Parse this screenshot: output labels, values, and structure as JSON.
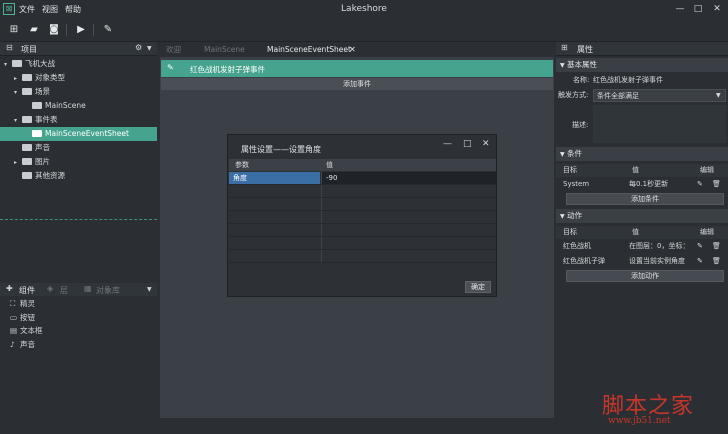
{
  "titlebar": {
    "title": "Lakeshore",
    "menu": [
      "文件",
      "视图",
      "帮助"
    ],
    "app_icon": "app-logo-icon",
    "controls": [
      "—",
      "□",
      "✕"
    ]
  },
  "toolbar": {
    "icons": [
      "new-project-icon",
      "open-folder-icon",
      "save-icon",
      "play-icon",
      "brush-icon"
    ],
    "glyphs": [
      "⊞",
      "▰",
      "◙",
      "▶",
      "✎"
    ]
  },
  "project_panel": {
    "title": "项目",
    "tree": [
      {
        "label": "飞机大战",
        "depth": 0,
        "arrow": "▾",
        "icon": "project"
      },
      {
        "label": "对象类型",
        "depth": 1,
        "arrow": "▸",
        "icon": "folder"
      },
      {
        "label": "场景",
        "depth": 1,
        "arrow": "▾",
        "icon": "folder"
      },
      {
        "label": "MainScene",
        "depth": 2,
        "arrow": "",
        "icon": "scene"
      },
      {
        "label": "事件表",
        "depth": 1,
        "arrow": "▾",
        "icon": "folder"
      },
      {
        "label": "MainSceneEventSheet",
        "depth": 2,
        "arrow": "",
        "icon": "sheet",
        "selected": true
      },
      {
        "label": "声音",
        "depth": 1,
        "arrow": "",
        "icon": "folder"
      },
      {
        "label": "图片",
        "depth": 1,
        "arrow": "▸",
        "icon": "folder"
      },
      {
        "label": "其他资源",
        "depth": 1,
        "arrow": "",
        "icon": "folder"
      }
    ]
  },
  "components_panel": {
    "tabs": [
      "组件",
      "层",
      "对象库"
    ],
    "items": [
      {
        "label": "精灵",
        "icon": "sprite-icon",
        "glyph": "⛶"
      },
      {
        "label": "按钮",
        "icon": "button-icon",
        "glyph": "▭"
      },
      {
        "label": "文本框",
        "icon": "textbox-icon",
        "glyph": "▤"
      },
      {
        "label": "声音",
        "icon": "sound-icon",
        "glyph": "♪"
      }
    ]
  },
  "editor": {
    "tabs": [
      {
        "label": "欢迎",
        "active": false
      },
      {
        "label": "MainScene",
        "active": false
      },
      {
        "label": "MainSceneEventSheet",
        "active": true
      }
    ],
    "tab_close": "✕",
    "event_title": "红色战机发射子弹事件",
    "add_event_label": "添加事件"
  },
  "dialog": {
    "title": "属性设置——设置角度",
    "controls": [
      "—",
      "□",
      "✕"
    ],
    "columns": [
      "参数",
      "值"
    ],
    "rows": [
      {
        "param": "角度",
        "value": "-90"
      },
      {
        "param": "",
        "value": ""
      },
      {
        "param": "",
        "value": ""
      },
      {
        "param": "",
        "value": ""
      },
      {
        "param": "",
        "value": ""
      },
      {
        "param": "",
        "value": ""
      },
      {
        "param": "",
        "value": ""
      }
    ],
    "ok_label": "确定"
  },
  "properties": {
    "title": "属性",
    "basic_section": "基本属性",
    "name_label": "名称:",
    "name_value": "红色战机发射子弹事件",
    "trigger_label": "触发方式:",
    "trigger_value": "条件全部满足",
    "desc_label": "描述:",
    "conditions_section": "条件",
    "conditions_columns": [
      "目标",
      "值",
      "编辑"
    ],
    "conditions_rows": [
      {
        "target": "System",
        "value": "每0.1秒更新"
      }
    ],
    "add_condition_label": "添加条件",
    "actions_section": "动作",
    "actions_columns": [
      "目标",
      "值",
      "编辑"
    ],
    "actions_rows": [
      {
        "target": "红色战机",
        "value": "在图层：0，坐标："
      },
      {
        "target": "红色战机子弹",
        "value": "设置当前实例角度"
      }
    ],
    "add_action_label": "添加动作"
  },
  "watermark": {
    "title": "脚本之家",
    "url": "www.jb51.net"
  },
  "colors": {
    "accent": "#46a38e",
    "background": "#2b2f33",
    "editor_bg": "#3b4046",
    "selected_cell": "#3a6ea5"
  }
}
